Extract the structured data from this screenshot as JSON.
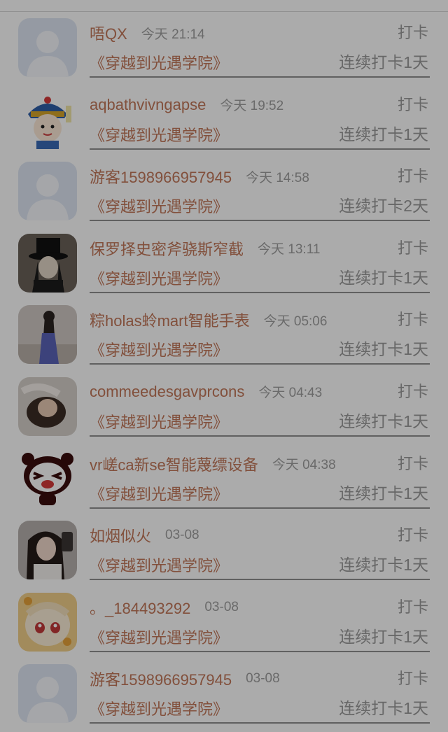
{
  "colors": {
    "username": "#c2785a",
    "secondary": "#9a9a9a",
    "divider": "#8f8f8f",
    "dim_overlay": "rgba(0,0,0,0.33)"
  },
  "entries": [
    {
      "username": "唔QX",
      "time": "今天 21:14",
      "action": "打卡",
      "book": "《穿越到光遇学院》",
      "streak": "连续打卡1天",
      "avatar_icon": "default-avatar-icon"
    },
    {
      "username": "aqbathvivngapse",
      "time": "今天 19:52",
      "action": "打卡",
      "book": "《穿越到光遇学院》",
      "streak": "连续打卡1天",
      "avatar_icon": "cartoon-official-avatar-icon"
    },
    {
      "username": "游客1598966957945",
      "time": "今天 14:58",
      "action": "打卡",
      "book": "《穿越到光遇学院》",
      "streak": "连续打卡2天",
      "avatar_icon": "default-avatar-icon"
    },
    {
      "username": "保罗择史密斧骁斯窄截",
      "time": "今天 13:11",
      "action": "打卡",
      "book": "《穿越到光遇学院》",
      "streak": "连续打卡1天",
      "avatar_icon": "top-hat-figure-avatar-icon"
    },
    {
      "username": "粽holas蛉mart智能手表",
      "time": "今天 05:06",
      "action": "打卡",
      "book": "《穿越到光遇学院》",
      "streak": "连续打卡1天",
      "avatar_icon": "girl-in-dress-avatar-icon"
    },
    {
      "username": "commeedesgavprcons",
      "time": "今天 04:43",
      "action": "打卡",
      "book": "《穿越到光遇学院》",
      "streak": "连续打卡1天",
      "avatar_icon": "lying-person-avatar-icon"
    },
    {
      "username": "vr嵯ca新se智能蔑缥设备",
      "time": "今天 04:38",
      "action": "打卡",
      "book": "《穿越到光遇学院》",
      "streak": "连续打卡1天",
      "avatar_icon": "panda-avatar-icon"
    },
    {
      "username": "如烟似火",
      "time": "03-08",
      "action": "打卡",
      "book": "《穿越到光遇学院》",
      "streak": "连续打卡1天",
      "avatar_icon": "girl-selfie-avatar-icon"
    },
    {
      "username": "。_184493292",
      "time": "03-08",
      "action": "打卡",
      "book": "《穿越到光遇学院》",
      "streak": "连续打卡1天",
      "avatar_icon": "anime-girl-avatar-icon"
    },
    {
      "username": "游客1598966957945",
      "time": "03-08",
      "action": "打卡",
      "book": "《穿越到光遇学院》",
      "streak": "连续打卡1天",
      "avatar_icon": "default-avatar-icon"
    }
  ]
}
